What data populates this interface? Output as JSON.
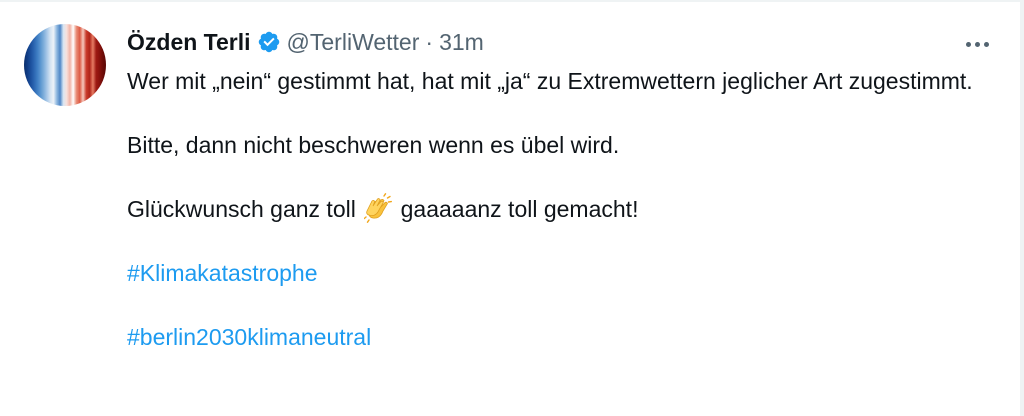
{
  "tweet": {
    "display_name": "Özden Terli",
    "handle": "@TerliWetter",
    "separator": "·",
    "time": "31m",
    "verified_color": "#1d9bf0",
    "text_line1": "Wer mit „nein“ gestimmt hat, hat mit „ja“ zu Extremwettern jeglicher Art zugestimmt.",
    "text_line2": "Bitte, dann nicht beschweren wenn es übel wird.",
    "text_line3_before": "Glückwunsch ganz toll",
    "text_line3_emoji": "clapping-hands-emoji",
    "text_line3_after": "gaaaaanz toll gemacht!",
    "hashtag1": "#Klimakatastrophe",
    "hashtag2": "#berlin2030klimaneutral",
    "hashtag_color": "#1d9bf0"
  },
  "icons": {
    "verified": "verified-badge-icon",
    "more": "more-options-icon",
    "avatar": "warming-stripes-avatar"
  }
}
